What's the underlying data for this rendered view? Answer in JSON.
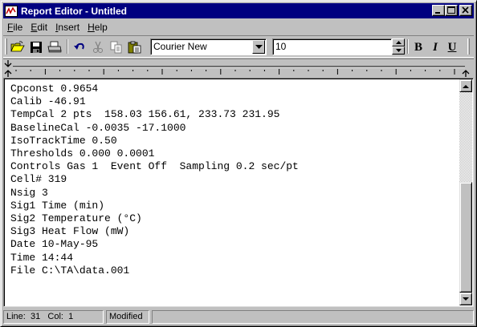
{
  "window": {
    "title": "Report Editor - Untitled"
  },
  "menu": [
    {
      "accel": "F",
      "rest": "ile"
    },
    {
      "accel": "E",
      "rest": "dit"
    },
    {
      "accel": "I",
      "rest": "nsert"
    },
    {
      "accel": "H",
      "rest": "elp"
    }
  ],
  "toolbar": {
    "font_name": "Courier New",
    "font_size": "10",
    "bold_label": "B",
    "italic_label": "I",
    "underline_label": "U",
    "icons": [
      "open-folder-icon",
      "save-disk-icon",
      "printer-icon",
      "undo-icon",
      "cut-scissors-icon",
      "copy-icon",
      "paste-icon"
    ]
  },
  "document": {
    "lines": [
      "Cpconst 0.9654",
      "Calib -46.91",
      "TempCal 2 pts  158.03 156.61, 233.73 231.95",
      "BaselineCal -0.0035 -17.1000",
      "IsoTrackTime 0.50",
      "Thresholds 0.000 0.0001",
      "Controls Gas 1  Event Off  Sampling 0.2 sec/pt",
      "Cell# 319",
      "Nsig 3",
      "Sig1 Time (min)",
      "Sig2 Temperature (°C)",
      "Sig3 Heat Flow (mW)",
      "Date 10-May-95",
      "Time 14:44",
      "File C:\\TA\\data.001"
    ]
  },
  "status": {
    "line_label": "Line:",
    "line_value": "31",
    "col_label": "Col:",
    "col_value": "1",
    "state": "Modified"
  },
  "colors": {
    "titlebar": "#000080",
    "face": "#c0c0c0"
  }
}
